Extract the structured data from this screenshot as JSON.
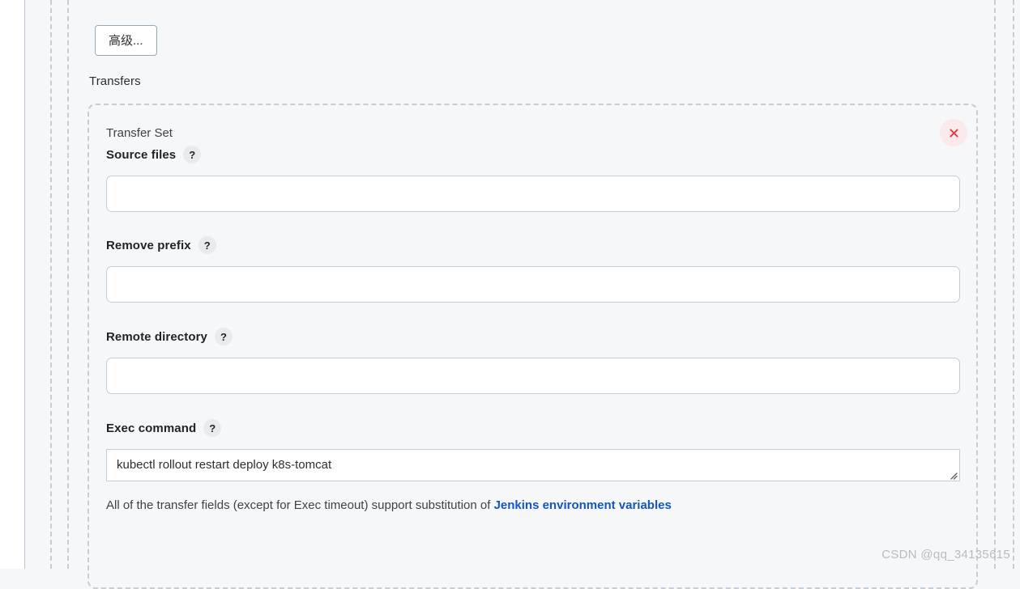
{
  "window": {
    "background_color": "#f6f7f8",
    "watermark": "CSDN @qq_34135615"
  },
  "advanced": {
    "label": "高级..."
  },
  "transfers": {
    "heading": "Transfers",
    "transfer_set": {
      "title": "Transfer Set",
      "remove_icon": "close-icon",
      "remove_icon_color": "#e5384a",
      "fields": [
        {
          "label": "Source files",
          "help": "?",
          "value": "",
          "placeholder": "",
          "type": "text"
        },
        {
          "label": "Remove prefix",
          "help": "?",
          "value": "",
          "placeholder": "",
          "type": "text"
        },
        {
          "label": "Remote directory",
          "help": "?",
          "value": "",
          "placeholder": "",
          "type": "text"
        },
        {
          "label": "Exec command",
          "help": "?",
          "value": "kubectl rollout restart deploy k8s-tomcat",
          "placeholder": "",
          "type": "textarea"
        }
      ],
      "footnote": {
        "text_before": "All of the transfer fields (except for Exec timeout) support substitution of ",
        "link_text": "Jenkins environment variables",
        "link_color": "#1355c1"
      }
    }
  }
}
